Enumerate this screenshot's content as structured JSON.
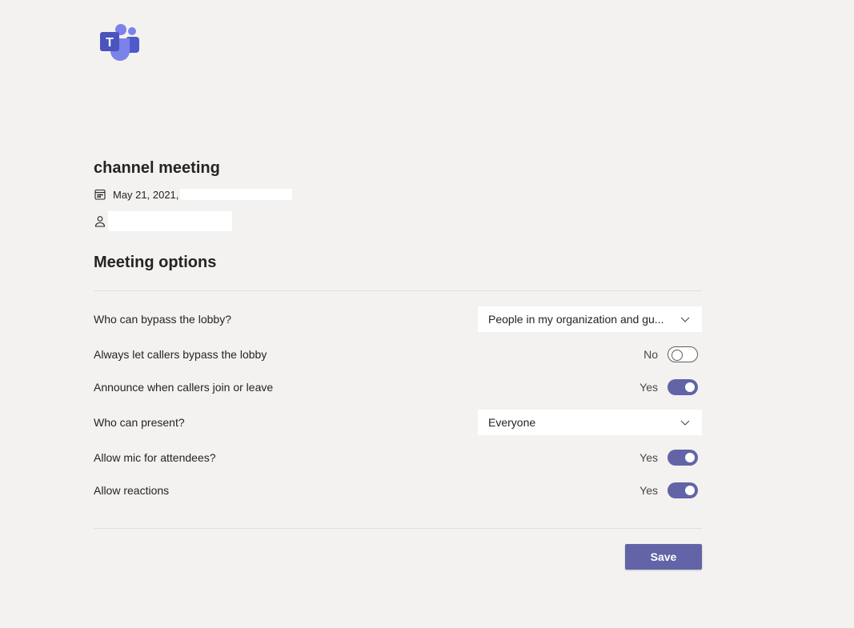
{
  "app": {
    "logo_icon": "microsoft-teams-logo",
    "logo_letter": "T",
    "brand_color": "#6264a7"
  },
  "meeting": {
    "title": "channel meeting",
    "date_text": "May 21, 2021,",
    "date_icon": "calendar-icon",
    "organizer_icon": "person-icon"
  },
  "options": {
    "section_title": "Meeting options",
    "bypass_lobby": {
      "label": "Who can bypass the lobby?",
      "selected": "People in my organization and gu..."
    },
    "callers_bypass": {
      "label": "Always let callers bypass the lobby",
      "state_text": "No",
      "on": false
    },
    "announce_callers": {
      "label": "Announce when callers join or leave",
      "state_text": "Yes",
      "on": true
    },
    "who_can_present": {
      "label": "Who can present?",
      "selected": "Everyone"
    },
    "allow_mic": {
      "label": "Allow mic for attendees?",
      "state_text": "Yes",
      "on": true
    },
    "allow_reactions": {
      "label": "Allow reactions",
      "state_text": "Yes",
      "on": true
    }
  },
  "actions": {
    "save_label": "Save"
  }
}
